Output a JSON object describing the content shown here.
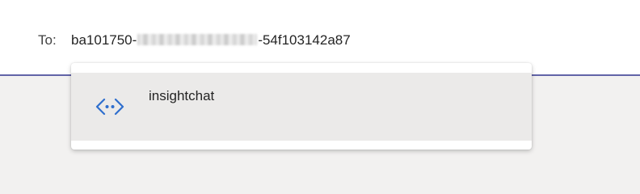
{
  "compose": {
    "to_label": "To:",
    "recipient_prefix": "ba101750-",
    "recipient_suffix": "-54f103142a87"
  },
  "suggestions": [
    {
      "label": "insightchat",
      "icon": "bot-icon"
    }
  ],
  "colors": {
    "accent_underline": "#6264a7",
    "icon_blue": "#2f6fce",
    "highlight_bg": "#ebeae9"
  }
}
